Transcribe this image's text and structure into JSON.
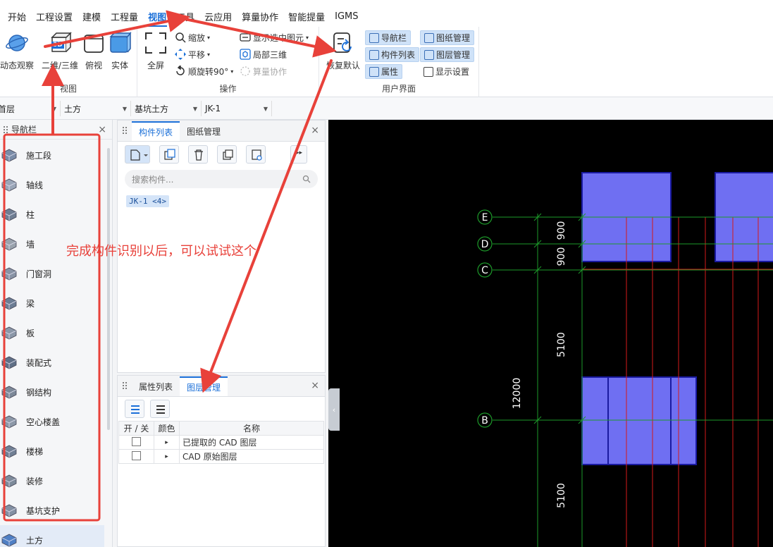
{
  "menu": {
    "items": [
      "开始",
      "工程设置",
      "建模",
      "工程量",
      "视图",
      "工具",
      "云应用",
      "算量协作",
      "智能提量",
      "IGMS"
    ],
    "active_index": 4
  },
  "ribbon": {
    "view_group": {
      "label": "视图",
      "dynamic_observe": "动态观察",
      "two_three_d": "二维/三维",
      "top_view": "俯视",
      "solid": "实体",
      "badge_3d": "3D"
    },
    "ops_group": {
      "label": "操作",
      "fullscreen": "全屏",
      "zoom": "缩放",
      "pan": "平移",
      "rotate": "顺旋转90°",
      "show_selected": "显示选中图元",
      "local_3d": "局部三维",
      "collab": "算量协作"
    },
    "ui_group": {
      "label": "用户界面",
      "restore": "恢复默认",
      "nav_bar": "导航栏",
      "component_list": "构件列表",
      "properties": "属性",
      "drawing_mgmt": "图纸管理",
      "layer_mgmt": "图层管理",
      "display_settings": "显示设置"
    }
  },
  "selectors": {
    "floor": "首层",
    "category": "土方",
    "type": "基坑土方",
    "component": "JK-1"
  },
  "nav": {
    "title": "导航栏",
    "items": [
      "施工段",
      "轴线",
      "柱",
      "墙",
      "门窗洞",
      "梁",
      "板",
      "装配式",
      "钢结构",
      "空心楼盖",
      "楼梯",
      "装修",
      "基坑支护",
      "土方"
    ]
  },
  "component_panel": {
    "tabs": [
      "构件列表",
      "图纸管理"
    ],
    "search_placeholder": "搜索构件...",
    "item": "JK-1 <4>"
  },
  "layer_panel": {
    "tabs": [
      "属性列表",
      "图层管理"
    ],
    "headers": {
      "toggle": "开 / 关",
      "color": "颜色",
      "name": "名称"
    },
    "rows": [
      "已提取的 CAD 图层",
      "CAD 原始图层"
    ]
  },
  "annotation": "完成构件识别以后，可以试试这个",
  "drawing": {
    "axes": [
      "E",
      "D",
      "C",
      "B"
    ],
    "dims": [
      "900",
      "900",
      "5100",
      "12000",
      "5100"
    ]
  },
  "colors": {
    "accent": "#1a6fd8",
    "annotation": "#e8413a",
    "canvas_bg": "#000000",
    "block_fill": "#6f6ff2",
    "grid_red": "#d51a1a",
    "axis_green": "#1d9a2a"
  }
}
